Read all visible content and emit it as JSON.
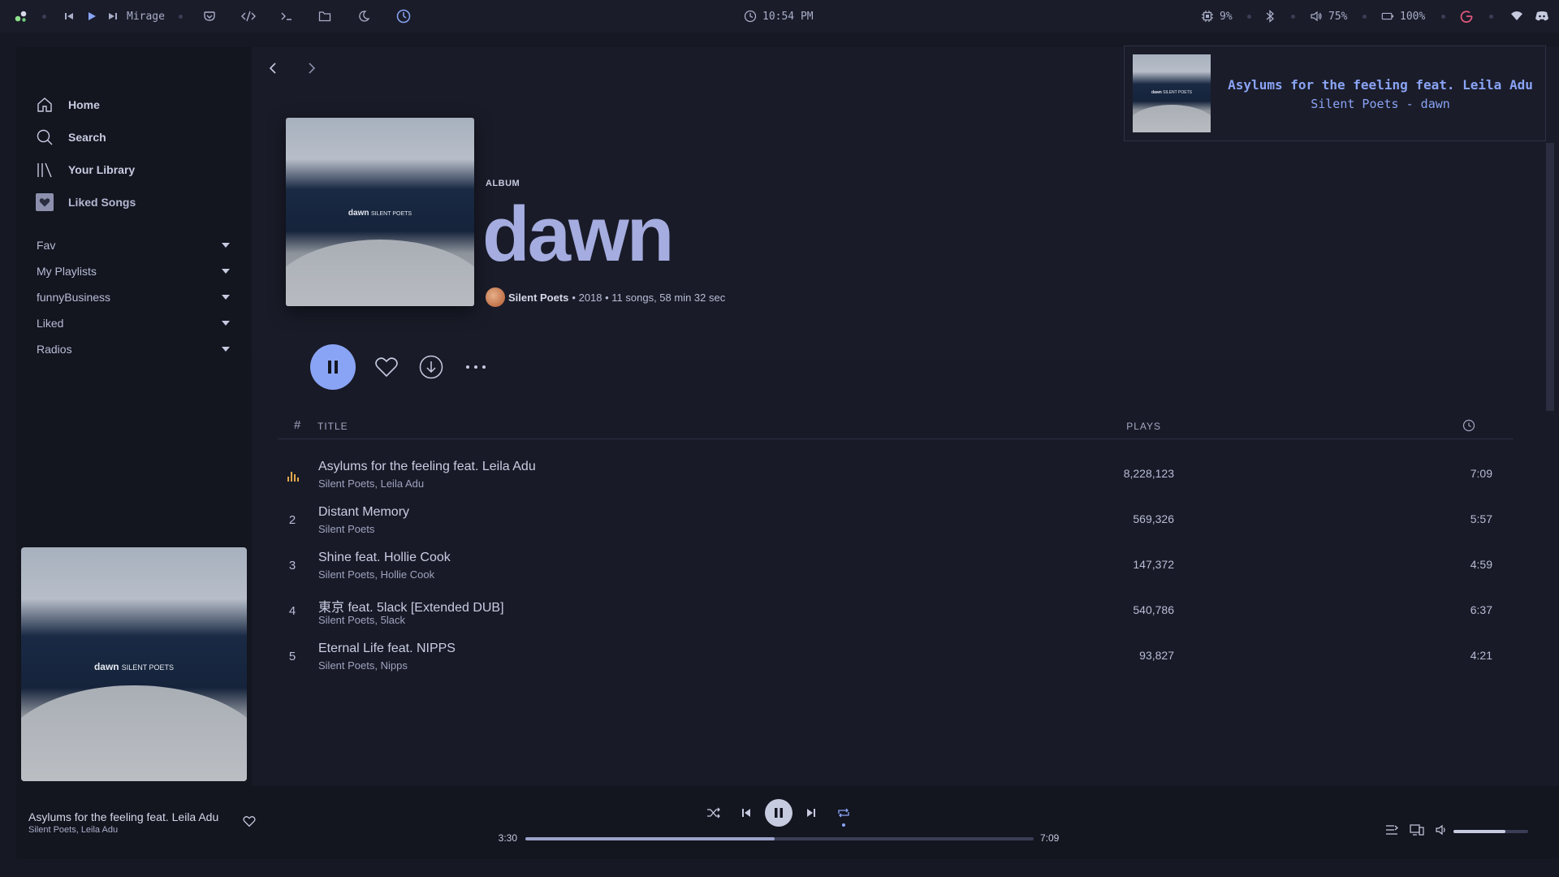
{
  "topbar": {
    "media_title": "Mirage",
    "clock": "10:54 PM",
    "cpu": "9%",
    "volume": "75%",
    "battery": "100%"
  },
  "nav": {
    "home": "Home",
    "search": "Search",
    "library": "Your Library",
    "liked": "Liked Songs"
  },
  "playlists": [
    "Fav",
    "My Playlists",
    "funnyBusiness",
    "Liked",
    "Radios"
  ],
  "cover": {
    "title": "dawn",
    "artist": "SILENT POETS"
  },
  "album": {
    "kind": "ALBUM",
    "title": "dawn",
    "artist": "Silent Poets",
    "meta": "• 2018 • 11 songs, 58 min 32 sec"
  },
  "table": {
    "col_num": "#",
    "col_title": "TITLE",
    "col_plays": "PLAYS",
    "tracks": [
      {
        "num": "",
        "title": "Asylums for the feeling feat. Leila Adu",
        "artists": "Silent Poets, Leila Adu",
        "plays": "8,228,123",
        "duration": "7:09",
        "playing": true
      },
      {
        "num": "2",
        "title": "Distant Memory",
        "artists": "Silent Poets",
        "plays": "569,326",
        "duration": "5:57"
      },
      {
        "num": "3",
        "title": "Shine feat. Hollie Cook",
        "artists": "Silent Poets, Hollie Cook",
        "plays": "147,372",
        "duration": "4:59"
      },
      {
        "num": "4",
        "title": "東京 feat. 5lack [Extended DUB]",
        "artists": "Silent Poets, 5lack",
        "plays": "540,786",
        "duration": "6:37"
      },
      {
        "num": "5",
        "title": "Eternal Life feat. NIPPS",
        "artists": "Silent Poets, Nipps",
        "plays": "93,827",
        "duration": "4:21"
      }
    ]
  },
  "player": {
    "title": "Asylums for the feeling feat. Leila Adu",
    "artists": "Silent Poets, Leila Adu",
    "elapsed": "3:30",
    "total": "7:09",
    "progress_fraction": 0.49,
    "volume_fraction": 0.7
  },
  "notification": {
    "line1": "Asylums for the feeling feat. Leila Adu",
    "line2": "Silent Poets - dawn"
  },
  "colors": {
    "accent": "#8aa4f5",
    "title": "#a5acdf",
    "eq": "#e3a84b"
  }
}
